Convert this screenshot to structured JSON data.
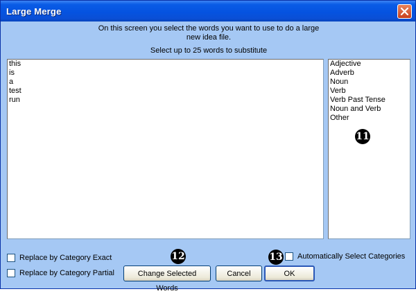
{
  "window": {
    "title": "Large Merge"
  },
  "instructions": {
    "line1": "On this screen you select the words you want to use to do a large",
    "line2": "new idea file.",
    "select_hint": "Select up to 25 words to substitute"
  },
  "words_list": [
    "this",
    "is",
    "a",
    "test",
    "run"
  ],
  "categories_list": [
    "Adjective",
    "Adverb",
    "Noun",
    "Verb",
    "Verb Past Tense",
    "Noun and Verb",
    "Other"
  ],
  "badges": {
    "b11": "11",
    "b12": "12",
    "b13": "13"
  },
  "options": {
    "replace_exact": "Replace by Category Exact",
    "replace_partial": "Replace by Category Partial",
    "auto_select": "Automatically Select Categories"
  },
  "buttons": {
    "change": "Change Selected Words",
    "cancel": "Cancel",
    "ok": "OK"
  }
}
